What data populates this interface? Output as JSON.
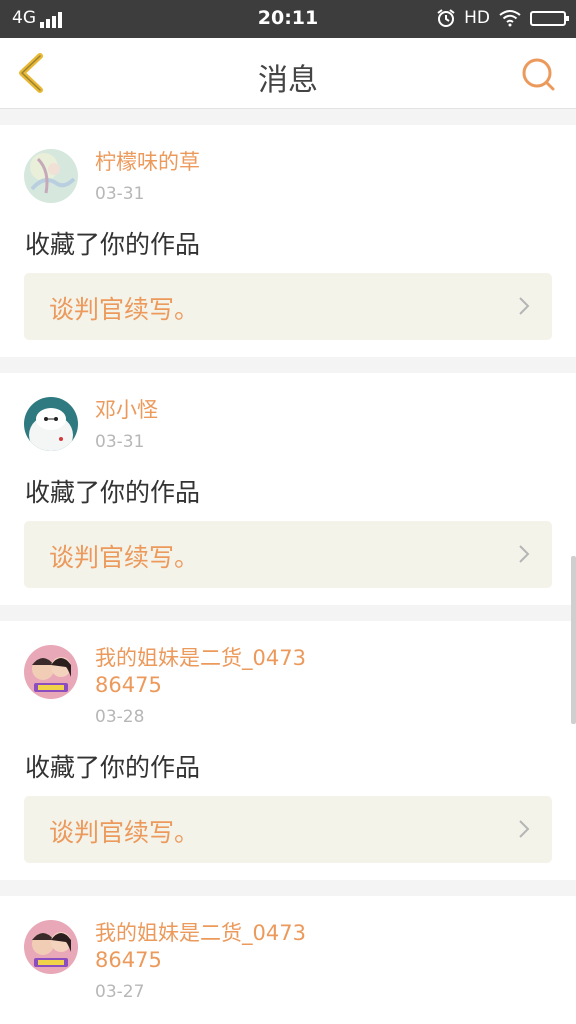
{
  "status_bar": {
    "network": "4G",
    "time": "20:11",
    "hd": "HD"
  },
  "header": {
    "title": "消息"
  },
  "messages": [
    {
      "name": "柠檬味的草",
      "date": "03-31",
      "action": "收藏了你的作品",
      "work": "谈判官续写。"
    },
    {
      "name": "邓小怪",
      "date": "03-31",
      "action": "收藏了你的作品",
      "work": "谈判官续写。"
    },
    {
      "name": "我的姐妹是二货_047386475",
      "date": "03-28",
      "action": "收藏了你的作品",
      "work": "谈判官续写。"
    },
    {
      "name": "我的姐妹是二货_047386475",
      "date": "03-27"
    }
  ],
  "colors": {
    "accent": "#ec9a5c",
    "status_bar": "#3d3d3d",
    "work_box": "#f3f3ea"
  }
}
